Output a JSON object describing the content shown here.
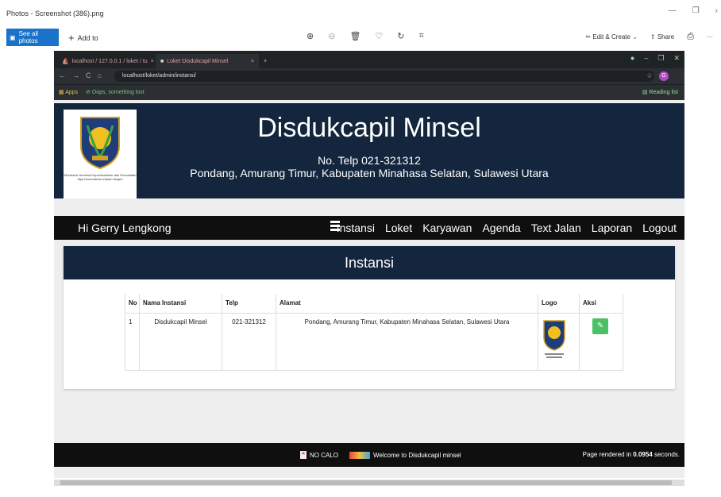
{
  "app": {
    "title": "Photos - Screenshot (386).png",
    "see_all_label": "See all photos",
    "add_to_label": "Add to",
    "edit_create_label": "Edit & Create",
    "share_label": "Share"
  },
  "browser": {
    "tabs": [
      "localhost / 127.0.0.1 / loket / tu",
      "Loket Disdukcapil Minsel"
    ],
    "url": "localhost/loket/admin/instansi/",
    "bookmarks": [
      "Apps",
      "Oops, something lost"
    ],
    "reading_list": "Reading list",
    "avatar": "G"
  },
  "site": {
    "title": "Disdukcapil Minsel",
    "telp": "No. Telp 021-321312",
    "address": "Pondang, Amurang Timur, Kabupaten Minahasa Selatan, Sulawesi Utara",
    "logo_caption": "Direktorat Jenderal Kependudukan dan Pencatatan Sipil Kementerian Dalam Negeri"
  },
  "nav": {
    "greeting": "Hi Gerry Lengkong",
    "items": [
      "Instansi",
      "Loket",
      "Karyawan",
      "Agenda",
      "Text Jalan",
      "Laporan",
      "Logout"
    ]
  },
  "panel": {
    "title": "Instansi",
    "headers": [
      "No",
      "Nama Instansi",
      "Telp",
      "Alamat",
      "Logo",
      "Aksi"
    ],
    "rows": [
      {
        "no": "1",
        "nama": "Disdukcapil Minsel",
        "telp": "021-321312",
        "alamat": "Pondang, Amurang Timur, Kabupaten Minahasa Selatan, Sulawesi Utara"
      }
    ]
  },
  "footer": {
    "nocalo": "NO CALO",
    "welcome": "Welcome to Disdukcapil minsel",
    "rendered_prefix": "Page rendered in ",
    "rendered_time": "0.0954",
    "rendered_suffix": " seconds."
  }
}
